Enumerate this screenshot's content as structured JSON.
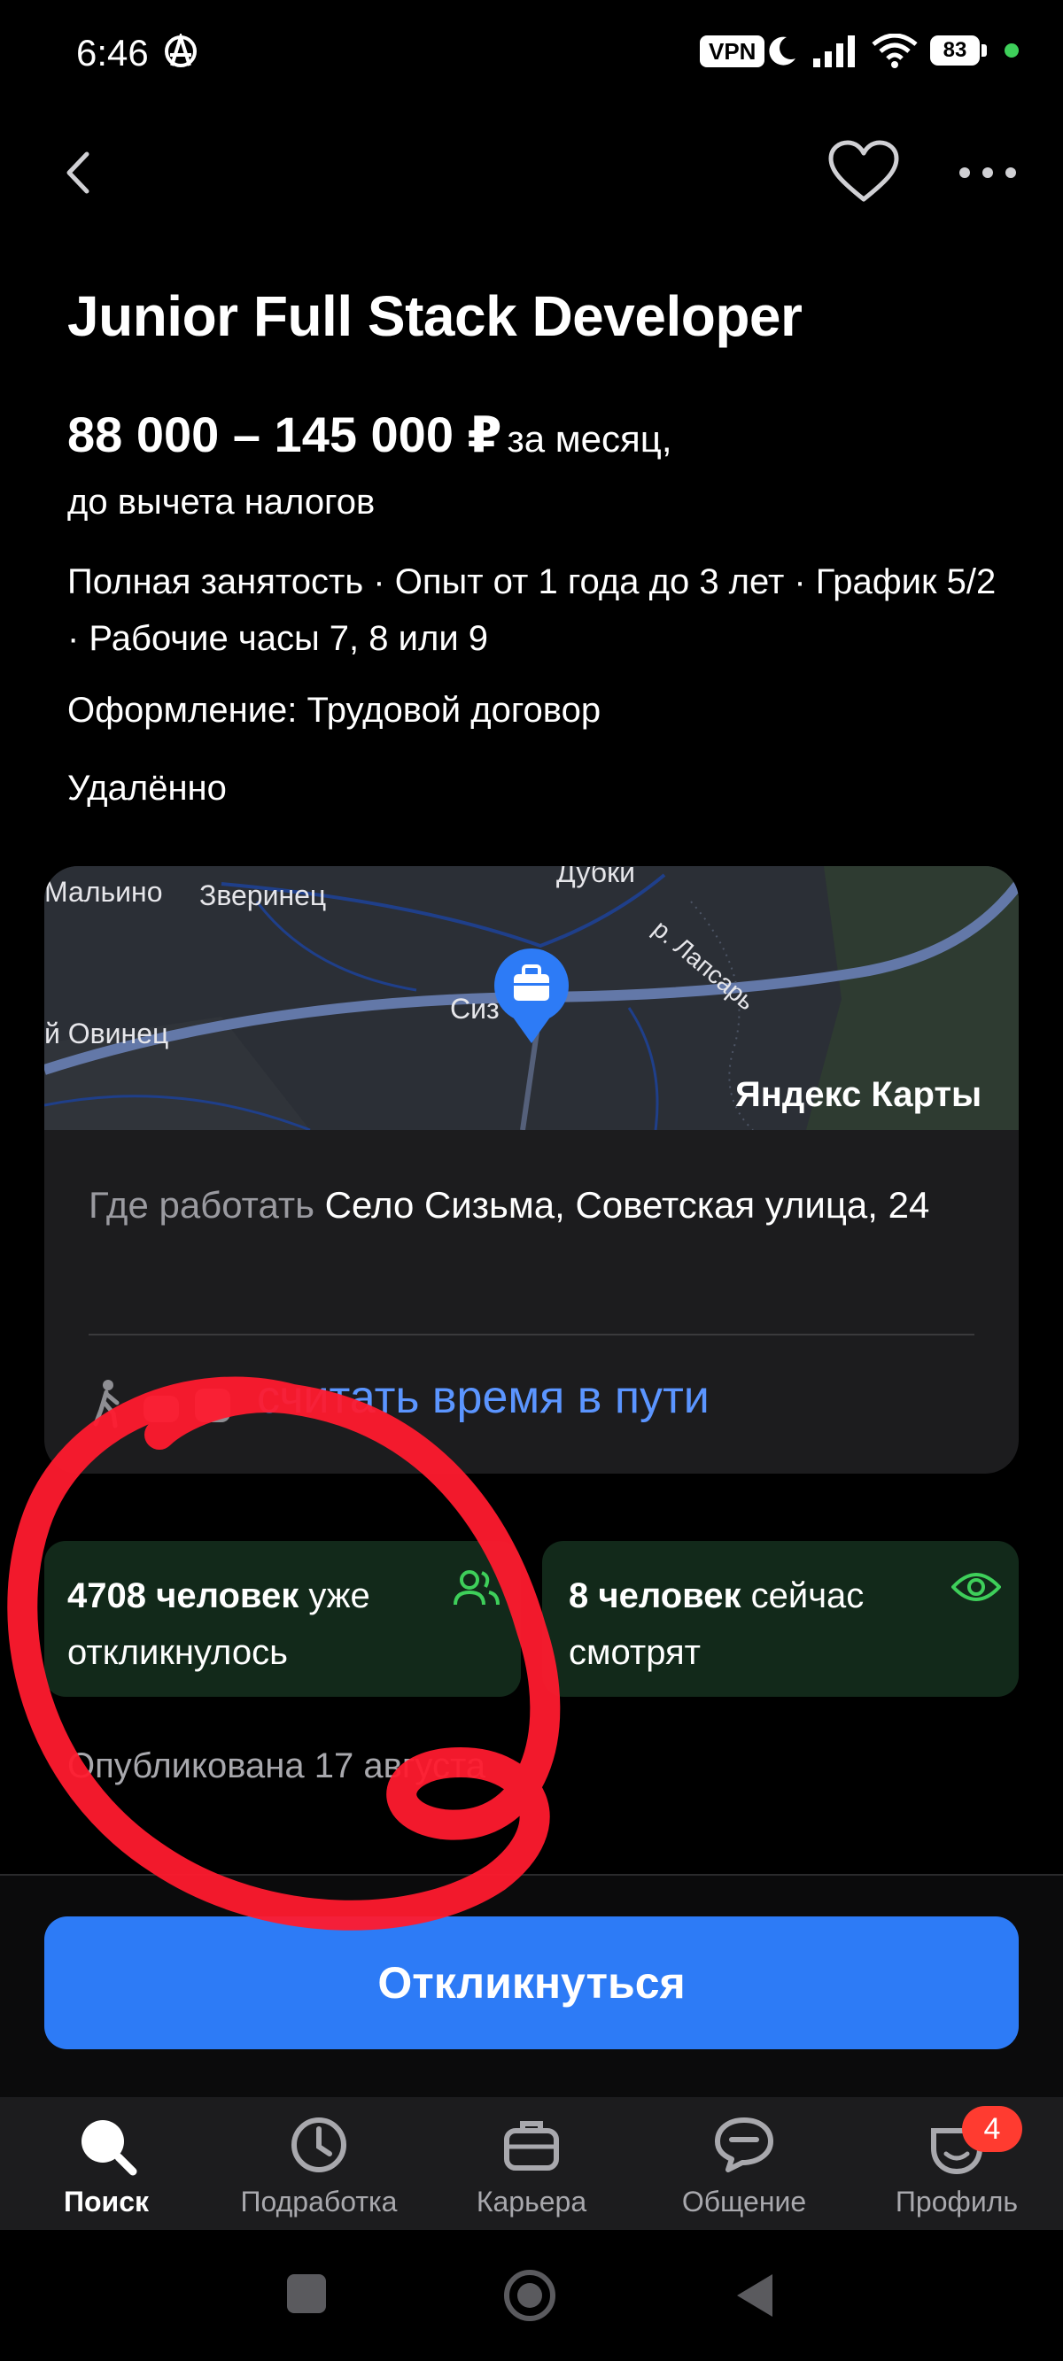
{
  "status_bar": {
    "time": "6:46",
    "vpn": "VPN",
    "battery": "83"
  },
  "vacancy": {
    "title": "Junior Full Stack Developer",
    "salary": "88 000 – 145 000 ₽",
    "salary_suffix": "за месяц,",
    "salary_note": "до вычета налогов",
    "conditions": "Полная занятость · Опыт от 1 года до 3 лет · График 5/2 · Рабочие часы 7, 8 или 9",
    "contract": "Оформление: Трудовой договор",
    "work_format": "Удалённо"
  },
  "map": {
    "brand": "Яндекс Карты",
    "labels": {
      "malino": "Мальино",
      "zverinets": "Зверинец",
      "dubki": "Дубки",
      "lapsar": "р. Лапсарь",
      "ovinets": "й Овинец",
      "sizma": "Сиз"
    },
    "where_label": "Где работать",
    "address": "Село Сизьма, Советская улица, 24",
    "route_link": "считать время в пути"
  },
  "stats": {
    "responded_bold": "4708 человек",
    "responded_rest": "уже откликнулось",
    "viewing_bold": "8 человек",
    "viewing_rest": "сейчас смотрят"
  },
  "published": "Опубликована 17 августа",
  "respond_button": "Откликнуться",
  "nav": {
    "items": [
      {
        "label": "Поиск",
        "icon": "search-icon"
      },
      {
        "label": "Подработка",
        "icon": "clock-icon"
      },
      {
        "label": "Карьера",
        "icon": "briefcase-icon"
      },
      {
        "label": "Общение",
        "icon": "chat-icon"
      },
      {
        "label": "Профиль",
        "icon": "profile-icon"
      }
    ],
    "profile_badge": "4"
  },
  "colors": {
    "accent": "#2d7bf6",
    "link": "#5b95ff",
    "chip_bg": "#12291a",
    "chip_icon": "#3ecf5a",
    "annotation": "#ff1a2e"
  }
}
